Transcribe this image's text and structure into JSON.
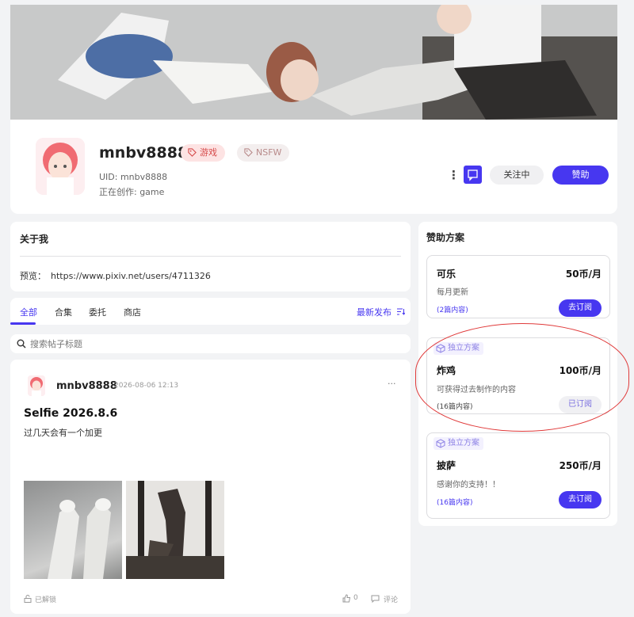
{
  "profile": {
    "username": "mnbv8888",
    "tags": [
      "游戏",
      "NSFW"
    ],
    "uid": "UID: mnbv8888",
    "creating": "正在创作:  game",
    "more": "⋮",
    "follow_label": "关注中",
    "sponsor_label": "赞助"
  },
  "about": {
    "title": "关于我",
    "preview_label": "预览：",
    "preview_url": "https://www.pixiv.net/users/4711326"
  },
  "tabs": [
    "全部",
    "合集",
    "委托",
    "商店"
  ],
  "sort_label": "最新发布",
  "search": {
    "placeholder": "搜索帖子标题"
  },
  "post": {
    "author": "mnbv8888",
    "time": "2026-08-06 12:13",
    "more": "···",
    "title": "Selfie 2026.8.6",
    "text": "过几天会有一个加更",
    "unlocked": "已解锁",
    "likes": "0",
    "comments": "评论"
  },
  "plans": {
    "title": "赞助方案",
    "items": [
      {
        "badge": "",
        "name": "可乐",
        "price": "50币/月",
        "desc": "每月更新",
        "count": "(2篇内容)",
        "button": "去订阅"
      },
      {
        "badge": "独立方案",
        "name": "炸鸡",
        "price": "100币/月",
        "desc": "可获得过去制作的内容",
        "count": "(16篇内容)",
        "button": "已订阅"
      },
      {
        "badge": "独立方案",
        "name": "披萨",
        "price": "250币/月",
        "desc": "感谢你的支持！！",
        "count": "(16篇内容)",
        "button": "去订阅"
      }
    ]
  },
  "colors": {
    "accent": "#4737f0",
    "highlight": "#e03a3a"
  }
}
